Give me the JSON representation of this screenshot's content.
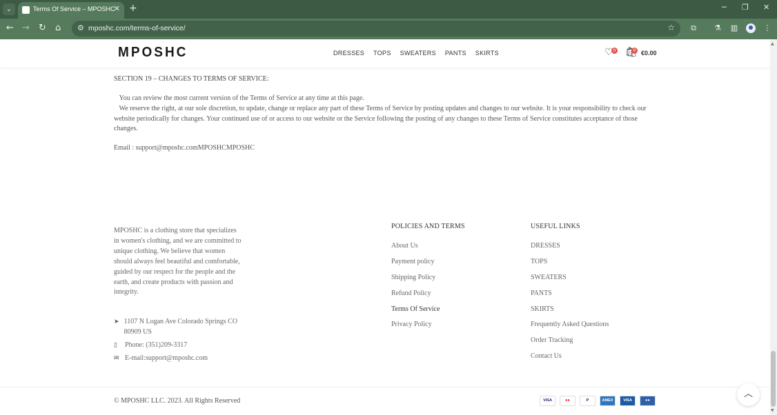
{
  "browser": {
    "tab_title": "Terms Of Service – MPOSHC",
    "url": "mposhc.com/terms-of-service/",
    "icons": {
      "tab_menu": "chevron-down-icon",
      "close_tab": "close-icon",
      "new_tab": "plus-icon",
      "minimize": "minimize-icon",
      "restore": "restore-icon",
      "close_window": "close-icon",
      "back": "back-arrow-icon",
      "forward": "forward-arrow-icon",
      "reload": "reload-icon",
      "home": "home-icon",
      "site_info": "site-info-icon",
      "bookmark": "star-icon",
      "extensions": "puzzle-icon",
      "labs": "flask-icon",
      "side_panel": "side-panel-icon",
      "profile": "profile-icon",
      "menu": "kebab-menu-icon"
    },
    "colors": {
      "tabbar": "#3d5a45",
      "toolbar": "#557a5c"
    }
  },
  "header": {
    "logo": "MPOSHC",
    "nav": [
      "DRESSES",
      "TOPS",
      "SWEATERS",
      "PANTS",
      "SKIRTS"
    ],
    "wishlist_count": "0",
    "cart_count": "0",
    "cart_total": "€0.00",
    "badge_color": "#e0524d"
  },
  "content": {
    "section_title": "SECTION 19 – CHANGES TO TERMS OF SERVICE:",
    "para1": "You can review the most current version of the Terms of Service at any time at this page.",
    "para2": "We reserve the right, at our sole discretion, to update, change or replace any part of these Terms of Service by posting updates and changes to our website. It is your responsibility to check our website periodically for changes. Your continued use of or access to our website or the Service following the posting of any changes to these Terms of Service constitutes acceptance of those changes.",
    "email_line": "Email : support@mposhc.comMPOSHCMPOSHC"
  },
  "footer": {
    "about": "MPOSHC is a clothing store that specializes in women's clothing, and we are committed to unique clothing. We believe that women should always feel beautiful and comfortable, guided by our respect for the people and the earth, and create products with passion and integrity.",
    "address": "1107 N Logan Ave Colorado Springs CO 80909 US",
    "phone": "Phone: (351)209-3317",
    "email": "E-mail:support@mposhc.com",
    "policies_title": "POLICIES AND TERMS",
    "policies": [
      "About Us",
      "Payment policy",
      "Shipping Policy",
      "Refund Policy",
      "Terms Of Service",
      "Privacy Policy"
    ],
    "useful_title": "USEFUL LINKS",
    "useful": [
      "DRESSES",
      "TOPS",
      "SWEATERS",
      "PANTS",
      "SKIRTS",
      "Frequently Asked Questions",
      "Order Tracking",
      "Contact Us"
    ],
    "copyright": "© MPOSHC LLC. 2023. All Rights Reserved",
    "payments": [
      {
        "name": "VISA",
        "bg": "#ffffff",
        "fg": "#1a1f71"
      },
      {
        "name": "Mastercard",
        "bg": "#ffffff",
        "fg": "#eb001b"
      },
      {
        "name": "PayPal",
        "bg": "#ffffff",
        "fg": "#003087"
      },
      {
        "name": "AMEX",
        "bg": "#2e77bc",
        "fg": "#ffffff"
      },
      {
        "name": "VISA Electron",
        "bg": "#1a5aa6",
        "fg": "#ffffff"
      },
      {
        "name": "Maestro",
        "bg": "#2f5fa8",
        "fg": "#ffffff"
      }
    ]
  }
}
